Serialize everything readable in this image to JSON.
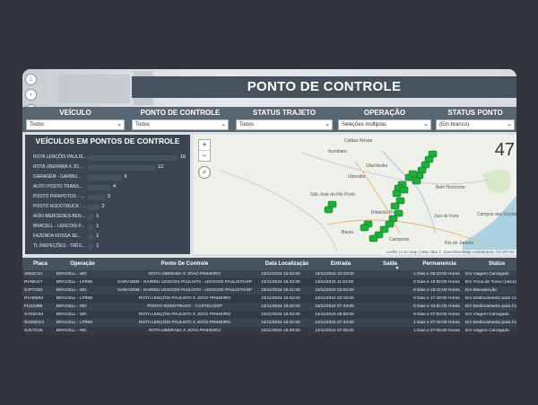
{
  "header": {
    "title": "PONTO DE CONTROLE",
    "nav_icons": [
      "home-icon",
      "back-icon",
      "forward-icon"
    ]
  },
  "filters": [
    {
      "label": "VEÍCULO",
      "value": "Todos"
    },
    {
      "label": "PONTO DE CONTROLE",
      "value": "Todos"
    },
    {
      "label": "STATUS TRAJETO",
      "value": "Todos"
    },
    {
      "label": "OPERAÇÃO",
      "value": "Seleções múltiplas"
    },
    {
      "label": "STATUS PONTO",
      "value": "(Em branco)"
    }
  ],
  "vehicles_panel": {
    "title": "VEÍCULOS EM PONTOS DE CONTROLE",
    "chart_data": {
      "type": "bar",
      "orientation": "horizontal",
      "categories": [
        "ROTA LENÇÕIS PAULIS...",
        "ROTA UBERABA X JO...",
        "GARAGEM - GARIBU...",
        "AUTO POSTO TRANS...",
        "POSTO PIRAPOTOS - ...",
        "POSTO RODOTRUCK - ...",
        "AOKI MERCEDES-BEN...",
        "BRACELL - LENCOIS P...",
        "FAZENDA NOSSA SE...",
        "TL INSPEÇÕES - TRÊS..."
      ],
      "values": [
        16,
        12,
        6,
        4,
        3,
        2,
        1,
        1,
        1,
        1
      ],
      "xlim": [
        0,
        16
      ]
    }
  },
  "map": {
    "count": "47",
    "attribution": "Leaflet | Icon Map | Map data © OpenStreetMap contributors, CC-BY-SA",
    "zoom_in": "+",
    "zoom_out": "−",
    "cities": [
      "Caldas Novas",
      "Itumbiara",
      "Uberlândia",
      "Uberaba",
      "Belo Horizonte",
      "São José do Rio Preto",
      "Ribeirão Preto",
      "Bauru",
      "Juiz de Fora",
      "Campos dos Goytacazes",
      "Campinas",
      "Rio de Janeiro"
    ]
  },
  "table": {
    "columns": [
      "Placa",
      "Operação",
      "Ponto De Controle",
      "Data Localização",
      "Entrada",
      "Saída",
      "Permanencia",
      "Status"
    ],
    "rows": [
      [
        "SMI3C34",
        "BRACELL - MG",
        "ROTA UBERABA X JOÃO PINHEIRO",
        "13/11/2024 16:42:00",
        "13/11/2024 10:23:00",
        "",
        "1 Dias e 06:20:00 Horas",
        "Em Viagem Carregado"
      ],
      [
        "RVN8J17",
        "BRACELL - LP/MS",
        "GARAGEM - GARIBU LENCOIS PAULISTA - LENCOIS PAULISTA/SP",
        "13/11/2024 16:42:00",
        "13/11/2024 11:53:00",
        "",
        "0 Dias e 18:50:00 Horas",
        "Em Troca de Turno (Vazio)"
      ],
      [
        "SJF7G34",
        "BRACELL - MG",
        "GARAGEM - GARIBU LENCOIS PAULISTA - LENCOIS PAULISTA/SP",
        "13/11/2024 16:41:00",
        "13/11/2024 22:02:00",
        "",
        "0 Dias e 18:41:00 Horas",
        "Em Manutenção"
      ],
      [
        "RVH8E82",
        "BRACELL - LP/MS",
        "ROTA LENÇÕIS PAULISTA X JOÃO PINHEIRO",
        "13/11/2024 16:42:00",
        "13/11/2024 23:15:00",
        "",
        "0 Dias e 17:28:00 Horas",
        "Em Deslocamento para Coleta(Vazio)"
      ],
      [
        "FUS2385",
        "BRACELL - MG",
        "POSTO RODOTRUCK - CASTELO/SP",
        "13/11/2024 16:42:00",
        "13/11/2024 07:43:00",
        "",
        "0 Dias e 10:51:00 Horas",
        "Em Deslocamento para Coleta(Vazio)"
      ],
      [
        "SYD4C64",
        "BRACELL - MG",
        "ROTA LENÇÕIS PAULISTA X JOÃO PINHEIRO",
        "13/11/2024 16:42:00",
        "13/11/2024 08:58:00",
        "",
        "0 Dias e 07:53:00 Horas",
        "Em Viagem Carregado"
      ],
      [
        "SUO8D13",
        "BRACELL - LP/MS",
        "ROTA LENÇÕIS PAULISTA X JOÃO PINHEIRO",
        "13/11/2024 16:42:00",
        "13/11/2024 07:43:00",
        "",
        "1 Dias e 07:42:00 Horas",
        "Em Deslocamento para Coleta(Vazio)"
      ],
      [
        "SJK7G26",
        "BRACELL - MG",
        "ROTA UBERABA X JOÃO PINHEIRO",
        "13/11/2024 16:38:00",
        "13/11/2024 07:05:00",
        "",
        "1 Dias e 07:06:00 Horas",
        "Em Viagem Carregado"
      ]
    ]
  },
  "colors": {
    "background": "#31333d",
    "header_bar": "#47525f",
    "filter_bar": "#5a6572",
    "panel": "#3b4552",
    "marker": "#1fae3a"
  }
}
